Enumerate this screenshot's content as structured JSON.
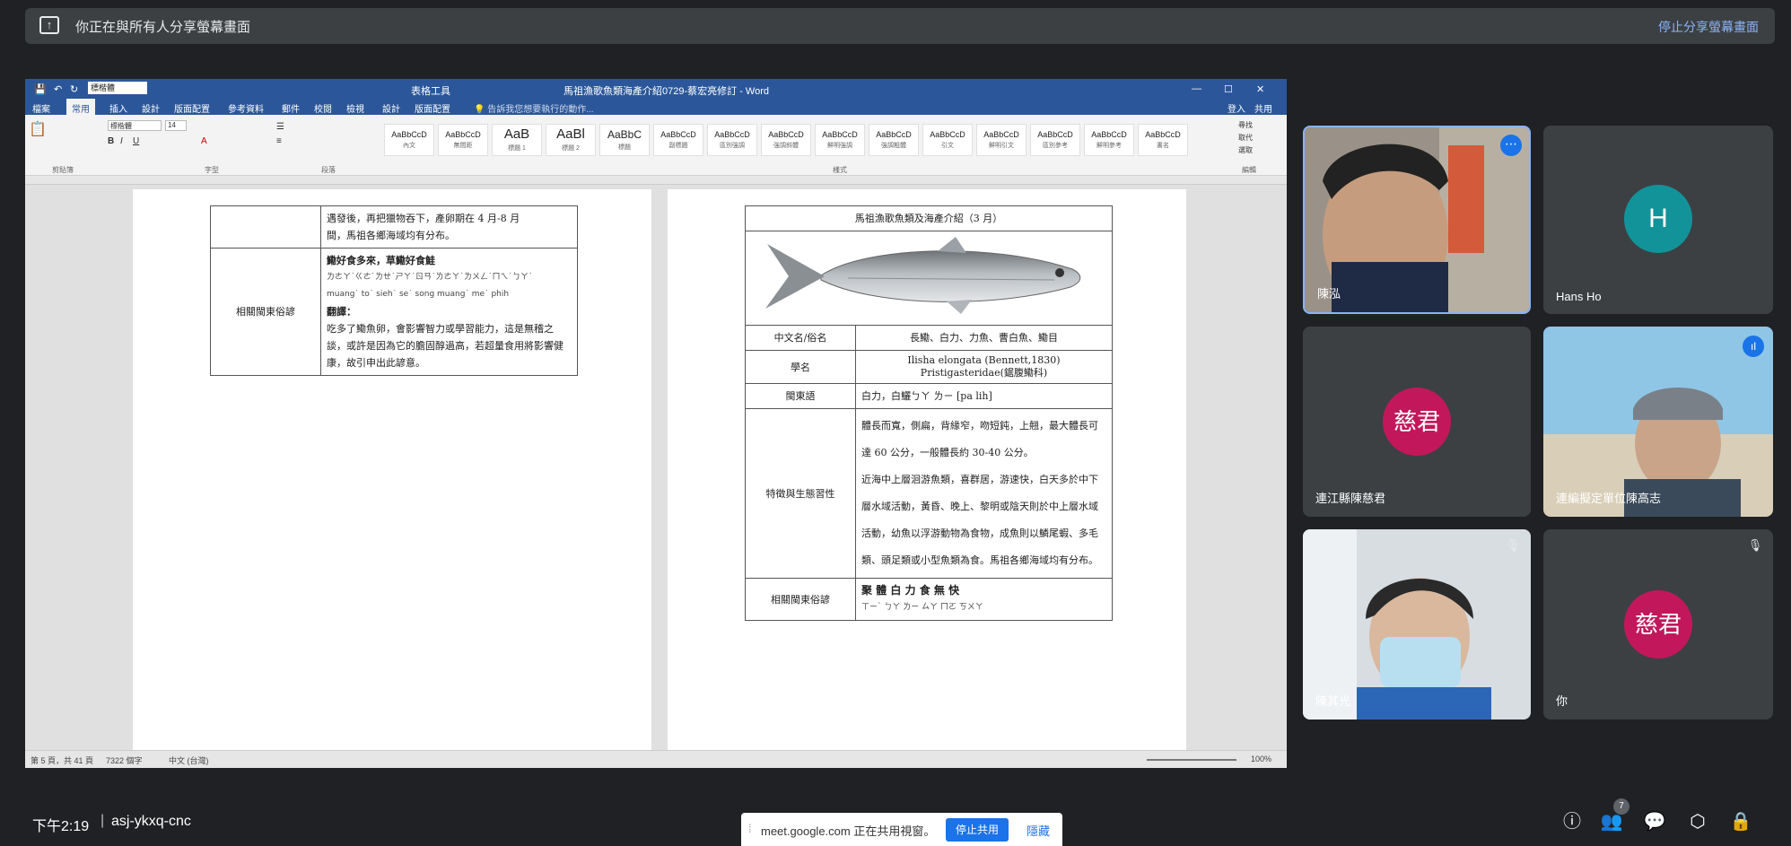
{
  "banner": {
    "share_text": "你正在與所有人分享螢幕畫面",
    "stop_label": "停止分享螢幕畫面"
  },
  "word": {
    "title": "馬祖漁歌魚類海產介紹0729-蔡宏亮修訂 - Word",
    "context_tab": "表格工具",
    "tell_me": "告訴我您想要執行的動作...",
    "login": "登入",
    "share": "共用",
    "font_name": "標楷體",
    "font_size": "14",
    "tabs": [
      "檔案",
      "常用",
      "插入",
      "設計",
      "版面配置",
      "參考資料",
      "郵件",
      "校閱",
      "檢視",
      "設計",
      "版面配置"
    ],
    "group_labels": [
      "剪貼簿",
      "字型",
      "段落",
      "樣式",
      "編輯"
    ],
    "styles": [
      {
        "preview": "AaBbCcD",
        "name": "內文"
      },
      {
        "preview": "AaBbCcD",
        "name": "無間距"
      },
      {
        "preview": "AaB",
        "name": "標題 1"
      },
      {
        "preview": "AaBl",
        "name": "標題 2"
      },
      {
        "preview": "AaBbC",
        "name": "標題"
      },
      {
        "preview": "AaBbCcD",
        "name": "副標題"
      },
      {
        "preview": "AaBbCcD",
        "name": "區別強調"
      },
      {
        "preview": "AaBbCcD",
        "name": "強調斜體"
      },
      {
        "preview": "AaBbCcD",
        "name": "鮮明強調"
      },
      {
        "preview": "AaBbCcD",
        "name": "強調粗體"
      },
      {
        "preview": "AaBbCcD",
        "name": "引文"
      },
      {
        "preview": "AaBbCcD",
        "name": "鮮明引文"
      },
      {
        "preview": "AaBbCcD",
        "name": "區別參考"
      },
      {
        "preview": "AaBbCcD",
        "name": "鮮明參考"
      },
      {
        "preview": "AaBbCcD",
        "name": "書名"
      }
    ],
    "editing": [
      "尋找",
      "取代",
      "選取"
    ],
    "status": {
      "page": "第 5 頁，共 41 頁",
      "words": "7322 個字",
      "lang": "中文 (台灣)",
      "zoom": "100%"
    }
  },
  "doc": {
    "left_table": {
      "row1_text_line1": "遇發後，再把獵物吞下，產卵期在 4 月-8 月",
      "row1_text_line2": "間，馬祖各鄉海域均有分布。",
      "row2_label": "相關閩東俗諺",
      "row2_title": "鰳好食多來，草鰳好食鮭",
      "row2_bopomofo": "ㄌㄜㄚ˙ㄍㄜ˙ㄌㄝ˙ㄕㄚ˙ㄖㄢ˙ㄌㄜㄚ˙ㄌㄨㄥ˙ㄇㄟ˙ㄅㄚ˙",
      "row2_roman": "muang˙ to˙ sieh˙ se˙ song muang˙ me˙ phih",
      "row2_translate_label": "翻譯：",
      "row2_translation": "吃多了鰳魚卵，會影響智力或學習能力，這是無稽之談，或許是因為它的膽固醇過高，若超量食用將影響健康，故引申出此諺意。"
    },
    "right_table": {
      "title": "馬祖漁歌魚類及海產介紹（3 月）",
      "rows": [
        {
          "label": "中文名/俗名",
          "value": "長鰳、白力、力魚、曹白魚、鰳目"
        },
        {
          "label": "學名",
          "value": "Ilisha elongata (Bennett,1830) Pristigasteridae(鋸腹鰳科)"
        },
        {
          "label": "閩東語",
          "value": "白力，白鱺ㄅㄚ ㄌㄧ [pa lih]"
        }
      ],
      "habit_label": "特徵與生態習性",
      "habit_p1": "體長而寬，側扁，背緣窄，吻短鈍，上翹，最大體長可達 60 公分，一般體長約 30-40 公分。",
      "habit_p2": "近海中上層洄游魚類，喜群居，游速快，白天多於中下層水域活動，黃昏、晚上、黎明或陰天則於中上層水域活動，幼魚以浮游動物為食物，成魚則以鱗尾蝦、多毛類、頭足類或小型魚類為食。馬祖各鄉海域均有分布。",
      "proverb_label": "相關閩東俗諺",
      "proverb_title": "聚 體 白 力 食 無 快",
      "proverb_bopomofo": "ㄒㄧˋ ㄅㄚ ㄌㄧ ㄙㄚ ㄇㄛ ㄎㄨㄚ"
    }
  },
  "participants": [
    {
      "name": "陳泓",
      "type": "video"
    },
    {
      "name": "Hans Ho",
      "type": "avatar",
      "initial": "H",
      "color": "#12939a"
    },
    {
      "name": "連江縣陳慈君",
      "type": "avatar",
      "initial": "慈君",
      "color": "#c2185b"
    },
    {
      "name": "連編擬定單位陳高志",
      "type": "video"
    },
    {
      "name": "陳其光",
      "type": "video"
    },
    {
      "name": "你",
      "type": "avatar",
      "initial": "慈君",
      "color": "#c2185b"
    }
  ],
  "bottom": {
    "time": "下午2:19",
    "separator": "|",
    "code": "asj-ykxq-cnc",
    "notify_text": "meet.google.com 正在共用視窗。",
    "stop_share": "停止共用",
    "hide": "隱藏",
    "people_count": "7"
  }
}
